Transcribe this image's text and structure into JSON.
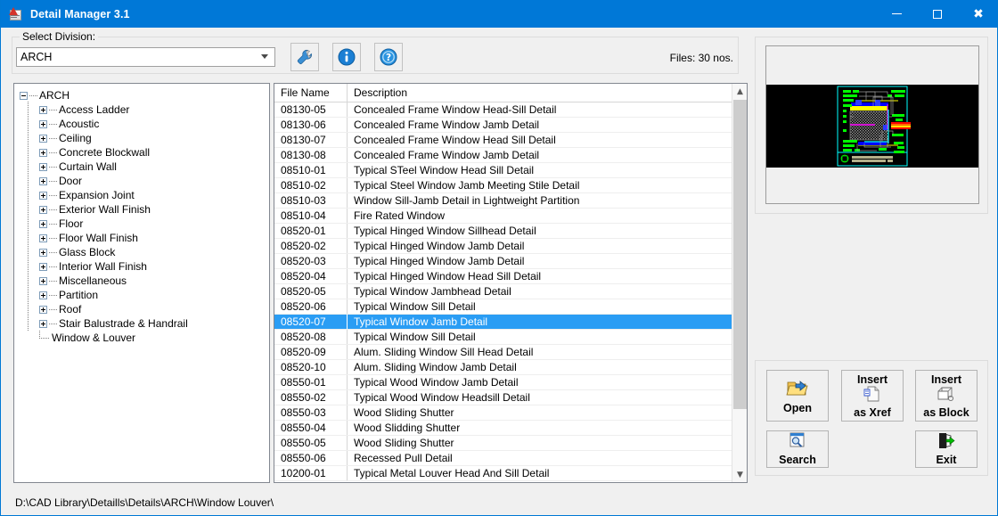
{
  "window": {
    "title": "Detail Manager 3.1",
    "icon": "autocad-detail-icon",
    "controls": {
      "minimize": "—",
      "maximize": "❐",
      "close": "✕"
    }
  },
  "toolbar": {
    "division_label": "Select Division:",
    "division_value": "ARCH",
    "division_options": [
      "ARCH"
    ],
    "settings_tooltip": "Settings",
    "info_tooltip": "Info",
    "help_tooltip": "Help",
    "files_count": "Files: 30 nos."
  },
  "tree": {
    "root": "ARCH",
    "items": [
      {
        "label": "Access Ladder",
        "expandable": true
      },
      {
        "label": "Acoustic",
        "expandable": true
      },
      {
        "label": "Ceiling",
        "expandable": true
      },
      {
        "label": "Concrete Blockwall",
        "expandable": true
      },
      {
        "label": "Curtain Wall",
        "expandable": true
      },
      {
        "label": "Door",
        "expandable": true
      },
      {
        "label": "Expansion Joint",
        "expandable": true
      },
      {
        "label": "Exterior Wall Finish",
        "expandable": true
      },
      {
        "label": "Floor",
        "expandable": true
      },
      {
        "label": "Floor Wall Finish",
        "expandable": true
      },
      {
        "label": "Glass Block",
        "expandable": true
      },
      {
        "label": "Interior Wall Finish",
        "expandable": true
      },
      {
        "label": "Miscellaneous",
        "expandable": true
      },
      {
        "label": "Partition",
        "expandable": true
      },
      {
        "label": "Roof",
        "expandable": true
      },
      {
        "label": "Stair Balustrade & Handrail",
        "expandable": true
      },
      {
        "label": "Window & Louver",
        "expandable": false
      }
    ]
  },
  "filelist": {
    "columns": [
      "File Name",
      "Description"
    ],
    "selected_index": 14,
    "rows": [
      {
        "file": "08130-05",
        "desc": "Concealed Frame Window Head-Sill Detail"
      },
      {
        "file": "08130-06",
        "desc": "Concealed Frame Window Jamb Detail"
      },
      {
        "file": "08130-07",
        "desc": "Concealed Frame Window Head Sill Detail"
      },
      {
        "file": "08130-08",
        "desc": "Concealed Frame Window Jamb Detail"
      },
      {
        "file": "08510-01",
        "desc": "Typical STeel Window Head Sill Detail"
      },
      {
        "file": "08510-02",
        "desc": "Typical Steel Window Jamb Meeting Stile Detail"
      },
      {
        "file": "08510-03",
        "desc": "Window Sill-Jamb Detail in Lightweight Partition"
      },
      {
        "file": "08510-04",
        "desc": "Fire Rated Window"
      },
      {
        "file": "08520-01",
        "desc": "Typical Hinged Window Sillhead Detail"
      },
      {
        "file": "08520-02",
        "desc": "Typical Hinged Window Jamb Detail"
      },
      {
        "file": "08520-03",
        "desc": "Typical Hinged Window Jamb Detail"
      },
      {
        "file": "08520-04",
        "desc": "Typical Hinged Window Head Sill Detail"
      },
      {
        "file": "08520-05",
        "desc": "Typical Window Jambhead Detail"
      },
      {
        "file": "08520-06",
        "desc": "Typical Window Sill Detail"
      },
      {
        "file": "08520-07",
        "desc": "Typical Window Jamb Detail"
      },
      {
        "file": "08520-08",
        "desc": "Typical Window Sill Detail"
      },
      {
        "file": "08520-09",
        "desc": "Alum. Sliding Window Sill Head Detail"
      },
      {
        "file": "08520-10",
        "desc": "Alum. Sliding Window Jamb Detail"
      },
      {
        "file": "08550-01",
        "desc": "Typical Wood Window Jamb Detail"
      },
      {
        "file": "08550-02",
        "desc": "Typical Wood Window Headsill Detail"
      },
      {
        "file": "08550-03",
        "desc": "Wood Sliding Shutter"
      },
      {
        "file": "08550-04",
        "desc": "Wood Slidding Shutter"
      },
      {
        "file": "08550-05",
        "desc": "Wood Sliding Shutter"
      },
      {
        "file": "08550-06",
        "desc": "Recessed Pull Detail"
      },
      {
        "file": "10200-01",
        "desc": "Typical Metal Louver Head And Sill Detail"
      }
    ]
  },
  "preview": {
    "name": "cad-drawing-preview",
    "background": "#000000",
    "accent": "#00ffff"
  },
  "actions": {
    "open": {
      "label": "Open",
      "icon": "open-folder-icon"
    },
    "xref": {
      "line1": "Insert",
      "line2": "as Xref",
      "icon": "xref-document-icon"
    },
    "block": {
      "line1": "Insert",
      "line2": "as Block",
      "icon": "block-icon"
    },
    "search": {
      "label": "Search",
      "icon": "magnifier-icon"
    },
    "exit": {
      "label": "Exit",
      "icon": "exit-door-icon"
    }
  },
  "statusbar": {
    "path": "D:\\CAD Library\\Detaills\\Details\\ARCH\\Window  Louver\\"
  }
}
